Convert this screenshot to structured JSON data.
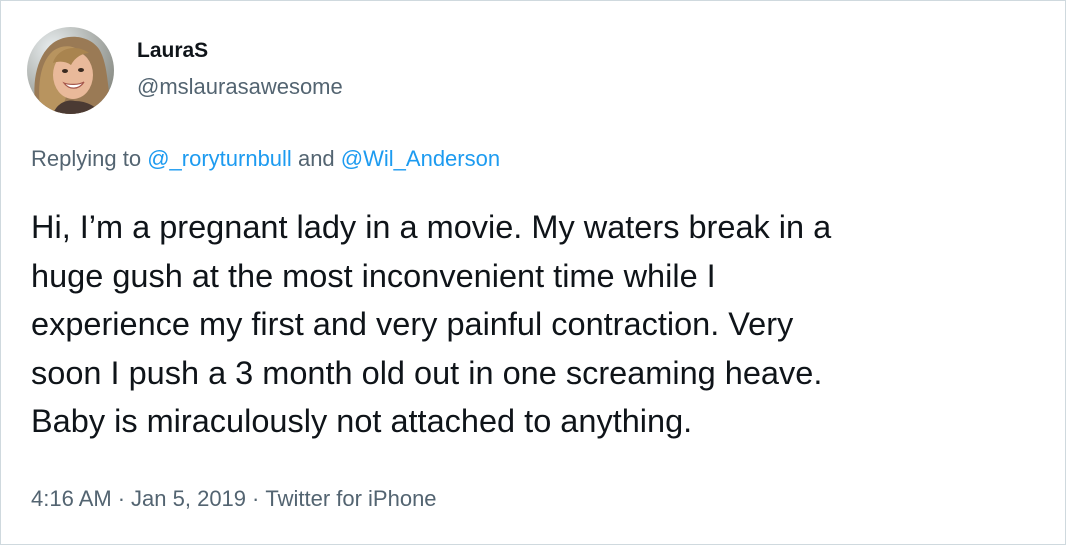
{
  "user": {
    "display_name": "LauraS",
    "handle": "@mslaurasawesome"
  },
  "reply": {
    "prefix": "Replying to",
    "mention_1": "@_roryturnbull",
    "conjunction": "and",
    "mention_2": "@Wil_Anderson"
  },
  "tweet": {
    "lines": [
      "Hi, I’m a pregnant lady in a movie. My waters break in a",
      "huge gush at the most inconvenient time while I",
      "experience my first and very painful contraction. Very",
      "soon I push a 3 month old out in one screaming heave.",
      "Baby is miraculously not attached to anything."
    ]
  },
  "meta": {
    "time": "4:16 AM",
    "separator": "·",
    "date": "Jan 5, 2019",
    "source": "Twitter for iPhone"
  },
  "colors": {
    "text": "#0f1419",
    "secondary": "#536471",
    "link": "#1d9bf0",
    "border": "#cfd9de"
  }
}
